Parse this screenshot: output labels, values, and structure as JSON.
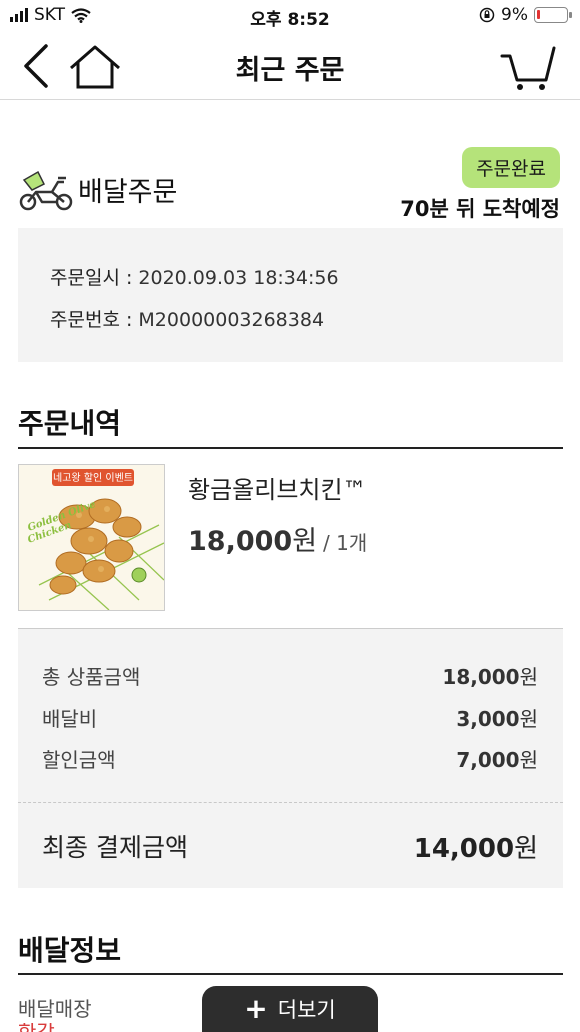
{
  "status_bar": {
    "carrier": "SKT",
    "time": "오후 8:52",
    "battery": "9%",
    "battery_level": 0.09,
    "battery_color": "#e23333"
  },
  "nav": {
    "title": "최근 주문",
    "back_icon": "chevron-left-icon",
    "home_icon": "home-icon",
    "cart_icon": "cart-icon"
  },
  "delivery": {
    "type_label": "배달주문",
    "status": "주문완료",
    "status_color": "#b5e37a",
    "eta": "70분 뒤 도착예정"
  },
  "order_info": {
    "date_label": "주문일시 : ",
    "date_value": "2020.09.03 18:34:56",
    "number_label": "주문번호 : ",
    "number_value": "M20000003268384"
  },
  "order_details": {
    "title": "주문내역",
    "product": {
      "banner": "네고왕 할인 이벤트",
      "img_text_1": "Golden Olive",
      "img_text_2": "Chicken",
      "name": "황금올리브치킨™",
      "price": "18,000",
      "unit": "원",
      "qty": "/ 1개"
    }
  },
  "summary": {
    "rows": [
      {
        "label": "총 상품금액",
        "amount": "18,000",
        "unit": "원"
      },
      {
        "label": "배달비",
        "amount": "3,000",
        "unit": "원"
      },
      {
        "label": "할인금액",
        "amount": "7,000",
        "unit": "원"
      }
    ],
    "total_label": "최종 결제금액",
    "total_amount": "14,000",
    "total_unit": "원"
  },
  "delivery_info": {
    "title": "배달정보",
    "store_label": "배달매장",
    "store_value_peek": "한강점"
  },
  "more_button": {
    "label": "더보기"
  }
}
